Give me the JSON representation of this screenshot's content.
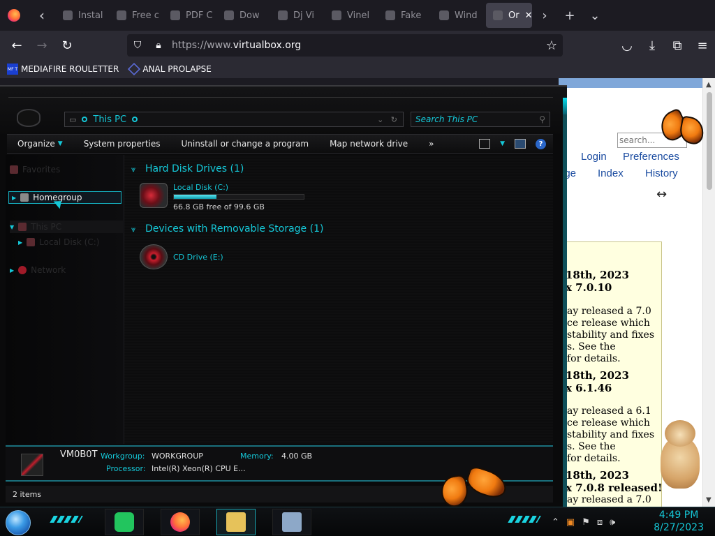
{
  "browser": {
    "tabs": [
      {
        "label": "Instal",
        "icon": "app-icon"
      },
      {
        "label": "Free c",
        "icon": "star-icon"
      },
      {
        "label": "PDF C",
        "icon": "pdf-icon"
      },
      {
        "label": "Dow",
        "icon": "download-icon"
      },
      {
        "label": "Dj Vi",
        "icon": "archive-icon"
      },
      {
        "label": "Vinel",
        "icon": "archive-icon"
      },
      {
        "label": "Fake",
        "icon": "robot-icon"
      },
      {
        "label": "Wind",
        "icon": "gear-icon"
      },
      {
        "label": "Or",
        "icon": "virtualbox-icon",
        "active": true
      }
    ],
    "url_proto": "https://www.",
    "url_host": "virtualbox.org",
    "bookmarks": [
      {
        "label": "MEDIAFIRE ROULETTER",
        "icon_text": "MF T"
      },
      {
        "label": "ANAL PROLAPSE"
      }
    ]
  },
  "website": {
    "search_placeholder": "search...",
    "links": {
      "login": "Login",
      "preferences": "Preferences",
      "page": "age",
      "index": "Index",
      "history": "History"
    },
    "news": [
      {
        "text": "18th, 2023",
        "bold": true
      },
      {
        "text": "x 7.0.10",
        "bold": true
      },
      {
        "text": "ay released a 7.0"
      },
      {
        "text": "ce release which"
      },
      {
        "text": "stability and fixes"
      },
      {
        "text": "s. See the"
      },
      {
        "text": "for details."
      },
      {
        "text": "18th, 2023",
        "bold": true
      },
      {
        "text": "x 6.1.46",
        "bold": true
      },
      {
        "text": "ay released a 6.1"
      },
      {
        "text": "ce release which"
      },
      {
        "text": "stability and fixes"
      },
      {
        "text": "s. See the"
      },
      {
        "text": "for details."
      },
      {
        "text": "18th, 2023",
        "bold": true
      },
      {
        "text": "x 7.0.8 released!",
        "bold": true
      },
      {
        "text": "ay released a 7.0"
      }
    ]
  },
  "explorer": {
    "address": "This PC",
    "search_placeholder": "Search This PC",
    "commands": {
      "organize": "Organize",
      "system_properties": "System properties",
      "uninstall": "Uninstall or change a program",
      "map_drive": "Map network drive",
      "more": "»"
    },
    "nav": {
      "favorites": "Favorites",
      "homegroup": "Homegroup",
      "this_pc": "This PC",
      "local_disk": "Local Disk (C:)",
      "network": "Network"
    },
    "groups": {
      "hdd": "Hard Disk Drives (1)",
      "removable": "Devices with Removable Storage (1)"
    },
    "drive_c": {
      "name": "Local Disk (C:)",
      "free_text": "66.8 GB free of 99.6 GB",
      "used_fraction": 0.33
    },
    "drive_e": {
      "name": "CD Drive (E:)"
    },
    "details": {
      "pc_name": "VM0B0T",
      "workgroup_label": "Workgroup:",
      "workgroup_value": "WORKGROUP",
      "memory_label": "Memory:",
      "memory_value": "4.00 GB",
      "processor_label": "Processor:",
      "processor_value": "Intel(R) Xeon(R) CPU E..."
    },
    "status": "2 items"
  },
  "taskbar": {
    "apps": [
      "notes-app",
      "firefox",
      "file-explorer",
      "monitor"
    ],
    "time": "4:49 PM",
    "date": "8/27/2023"
  }
}
